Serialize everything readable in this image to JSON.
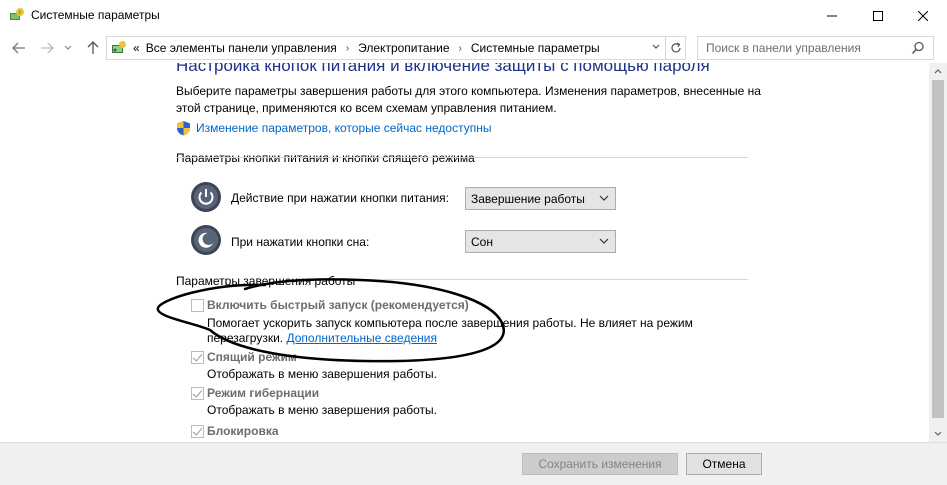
{
  "window": {
    "title": "Системные параметры",
    "minimize_icon": "minimize-icon",
    "maximize_icon": "maximize-icon",
    "close_icon": "close-icon"
  },
  "nav": {
    "back_icon": "back-arrow-icon",
    "forward_icon": "forward-arrow-icon",
    "recent_icon": "chevron-down-icon",
    "up_icon": "up-arrow-icon"
  },
  "address": {
    "overflow": "«",
    "crumbs": [
      "Все элементы панели управления",
      "Электропитание",
      "Системные параметры"
    ],
    "separator": "›"
  },
  "search": {
    "placeholder": "Поиск в панели управления"
  },
  "main": {
    "heading": "Настройка кнопок питания и включение защиты с помощью пароля",
    "description": "Выберите параметры завершения работы для этого компьютера. Изменения параметров, внесенные на этой странице, применяются ко всем схемам управления питанием.",
    "change_link": "Изменение параметров, которые сейчас недоступны",
    "buttons_section": "Параметры кнопки питания и кнопки спящего режима",
    "power_button_label": "Действие при нажатии кнопки питания:",
    "power_button_value": "Завершение работы",
    "sleep_button_label": "При нажатии кнопки сна:",
    "sleep_button_value": "Сон",
    "shutdown_section": "Параметры завершения работы",
    "fast_startup": {
      "label": "Включить быстрый запуск (рекомендуется)",
      "checked": false,
      "desc_line1": "Помогает ускорить запуск компьютера после завершения работы. Не влияет на режим",
      "desc_line2": "перезагрузки.",
      "link": "Дополнительные сведения"
    },
    "sleep": {
      "label": "Спящий режим",
      "checked": true,
      "desc": "Отображать в меню завершения работы."
    },
    "hibernate": {
      "label": "Режим гибернации",
      "checked": true,
      "desc": "Отображать в меню завершения работы."
    },
    "lock": {
      "label": "Блокировка",
      "checked": true
    }
  },
  "footer": {
    "save_label": "Сохранить изменения",
    "cancel_label": "Отмена"
  },
  "colors": {
    "heading": "#1e3287",
    "link": "#0066cc",
    "footer_bg": "#f0f0f0"
  }
}
